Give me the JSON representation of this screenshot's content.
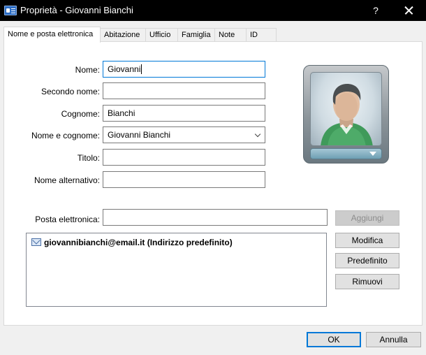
{
  "window": {
    "title": "Proprietà - Giovanni Bianchi",
    "help_glyph": "?",
    "icon": "contact-card-icon"
  },
  "tabs": [
    {
      "label": "Nome e posta elettronica",
      "active": true
    },
    {
      "label": "Abitazione",
      "active": false
    },
    {
      "label": "Ufficio",
      "active": false
    },
    {
      "label": "Famiglia",
      "active": false
    },
    {
      "label": "Note",
      "active": false
    },
    {
      "label": "ID",
      "active": false
    }
  ],
  "form": {
    "nome": {
      "label": "Nome:",
      "value": "Giovanni"
    },
    "secondo_nome": {
      "label": "Secondo nome:",
      "value": ""
    },
    "cognome": {
      "label": "Cognome:",
      "value": "Bianchi"
    },
    "nome_cognome": {
      "label": "Nome e cognome:",
      "value": "Giovanni Bianchi"
    },
    "titolo": {
      "label": "Titolo:",
      "value": ""
    },
    "nome_alternativo": {
      "label": "Nome alternativo:",
      "value": ""
    },
    "posta": {
      "label": "Posta elettronica:",
      "value": ""
    }
  },
  "email_list": [
    {
      "text": "giovannibianchi@email.it  (Indirizzo predefinito)",
      "icon": "envelope-icon"
    }
  ],
  "email_buttons": {
    "aggiungi": "Aggiungi",
    "modifica": "Modifica",
    "predefinito": "Predefinito",
    "rimuovi": "Rimuovi"
  },
  "footer": {
    "ok": "OK",
    "annulla": "Annulla"
  },
  "colors": {
    "titlebar": "#000000",
    "focus_border": "#0078d7",
    "dialog_bg": "#f0f0f0"
  }
}
